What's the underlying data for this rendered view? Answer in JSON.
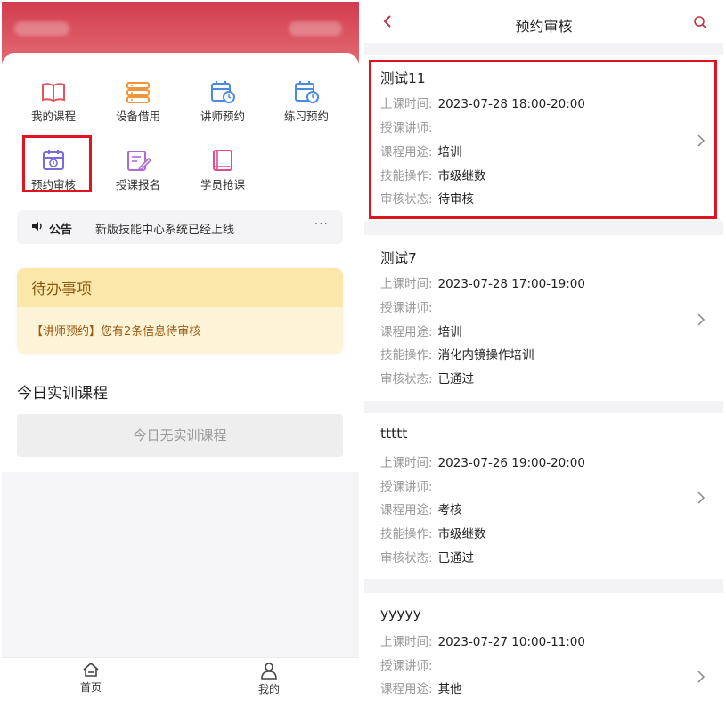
{
  "left": {
    "grid": [
      {
        "label": "我的课程",
        "icon": "book-icon"
      },
      {
        "label": "设备借用",
        "icon": "server-icon"
      },
      {
        "label": "讲师预约",
        "icon": "calendar-clock-icon"
      },
      {
        "label": "练习预约",
        "icon": "calendar-clock-icon"
      },
      {
        "label": "预约审核",
        "icon": "calendar-stamp-icon"
      },
      {
        "label": "授课报名",
        "icon": "edit-form-icon"
      },
      {
        "label": "学员抢课",
        "icon": "notebook-icon"
      }
    ],
    "notice": {
      "tag": "公告",
      "text": "新版技能中心系统已经上线",
      "more": "···"
    },
    "todo": {
      "title": "待办事项",
      "item": "【讲师预约】您有2条信息待审核"
    },
    "today": {
      "title": "今日实训课程",
      "empty": "今日无实训课程"
    },
    "tabbar": [
      {
        "label": "首页",
        "icon": "home-icon"
      },
      {
        "label": "我的",
        "icon": "user-icon"
      }
    ]
  },
  "right": {
    "title": "预约审核",
    "keys": {
      "time": "上课时间:",
      "teacher": "授课讲师:",
      "purpose": "课程用途:",
      "skill": "技能操作:",
      "status": "审核状态:"
    },
    "cards": [
      {
        "title": "测试11",
        "time": "2023-07-28 18:00-20:00",
        "teacher": "",
        "purpose": "培训",
        "skill": "市级继数",
        "status": "待审核"
      },
      {
        "title": "测试7",
        "time": "2023-07-28 17:00-19:00",
        "teacher": "",
        "purpose": "培训",
        "skill": "消化内镜操作培训",
        "status": "已通过"
      },
      {
        "title": "ttttt",
        "time": "2023-07-26 19:00-20:00",
        "teacher": "",
        "purpose": "考核",
        "skill": "市级继数",
        "status": "已通过"
      },
      {
        "title": "yyyyy",
        "time": "2023-07-27 10:00-11:00",
        "teacher": "",
        "purpose": "其他"
      }
    ]
  },
  "colors": {
    "brand_red": "#d23d4e",
    "highlight": "#e0141e",
    "todo_head": "#fce7aa",
    "todo_text": "#9a5810"
  }
}
